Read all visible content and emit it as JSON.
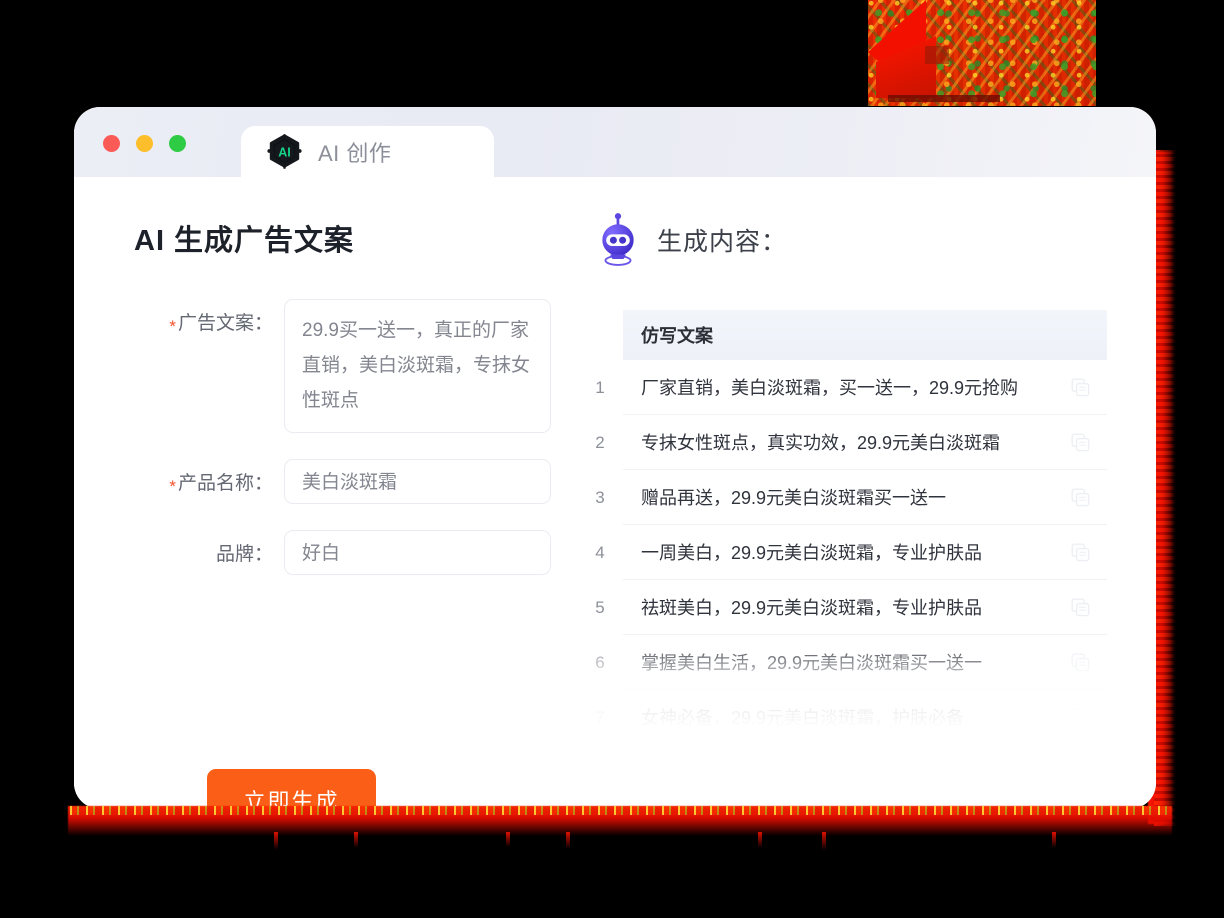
{
  "window": {
    "traffic_lights": [
      {
        "name": "close",
        "color": "#fb5b57"
      },
      {
        "name": "minimize",
        "color": "#fdbe2c"
      },
      {
        "name": "maximize",
        "color": "#2ecb44"
      }
    ],
    "tab": {
      "label": "AI 创作",
      "icon": "ai-hexagon-icon",
      "badge_text": "AI"
    }
  },
  "left": {
    "title": "AI 生成广告文案",
    "fields": [
      {
        "label": "广告文案：",
        "required": true,
        "type": "textarea",
        "value": "29.9买一送一，真正的厂家直销，美白淡斑霜，专抹女性斑点"
      },
      {
        "label": "产品名称：",
        "required": true,
        "type": "input",
        "value": "美白淡斑霜"
      },
      {
        "label": "品牌：",
        "required": false,
        "type": "input",
        "value": "好白"
      }
    ],
    "generate_button": "立即生成"
  },
  "right": {
    "header_title": "生成内容：",
    "robot_icon": "robot-icon",
    "table": {
      "column_header": "仿写文案",
      "rows": [
        {
          "num": "1",
          "text": "厂家直销，美白淡斑霜，买一送一，29.9元抢购"
        },
        {
          "num": "2",
          "text": "专抹女性斑点，真实功效，29.9元美白淡斑霜"
        },
        {
          "num": "3",
          "text": "赠品再送，29.9元美白淡斑霜买一送一"
        },
        {
          "num": "4",
          "text": "一周美白，29.9元美白淡斑霜，专业护肤品"
        },
        {
          "num": "5",
          "text": "祛斑美白，29.9元美白淡斑霜，专业护肤品"
        },
        {
          "num": "6",
          "text": "掌握美白生活，29.9元美白淡斑霜买一送一"
        },
        {
          "num": "7",
          "text": "女神必备，29.9元美白淡斑霜，护肤必备"
        }
      ],
      "row_action_icon": "copy-icon"
    }
  },
  "theme": {
    "accent_orange": "#fb5e17",
    "required_star": "#f5502c",
    "glow_red": "#ff1400",
    "badge_green": "#16d48a",
    "robot_purple": "#5b46e0"
  }
}
